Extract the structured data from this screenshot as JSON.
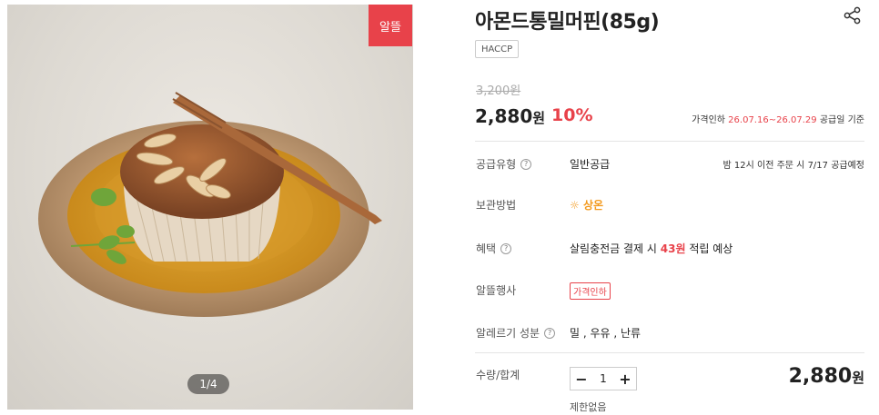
{
  "image": {
    "badge": "알뜰",
    "counter": "1/4"
  },
  "product": {
    "title": "아몬드통밀머핀(85g)",
    "tag": "HACCP",
    "original_price": "3,200원",
    "price_number": "2,880",
    "price_unit": "원",
    "discount": "10%"
  },
  "period": {
    "prefix": "가격인하",
    "dates": "26.07.16~26.07.29",
    "suffix": "공급일 기준"
  },
  "rows": {
    "supply_type": {
      "label": "공급유형",
      "value": "일반공급",
      "right": "밤 12시 이전 주문 시 7/17 공급예정"
    },
    "storage": {
      "label": "보관방법",
      "value": "상온"
    },
    "benefit": {
      "label": "혜택",
      "value_prefix": "살림충전금 결제 시",
      "value_amount": "43원",
      "value_suffix": "적립 예상"
    },
    "event": {
      "label": "알뜰행사",
      "chip": "가격인하"
    },
    "allergy": {
      "label": "알레르기 성분",
      "value": "밀 , 우유 , 난류"
    },
    "quantity": {
      "label": "수량/합계",
      "value": "1",
      "minus": "−",
      "plus": "+",
      "limit": "제한없음"
    }
  },
  "total": {
    "number": "2,880",
    "unit": "원"
  },
  "icons": {
    "share": "share-icon",
    "help": "question-circle-icon",
    "sun": "sun-icon"
  },
  "colors": {
    "accent": "#e8424a",
    "storage": "#f39a1e"
  }
}
